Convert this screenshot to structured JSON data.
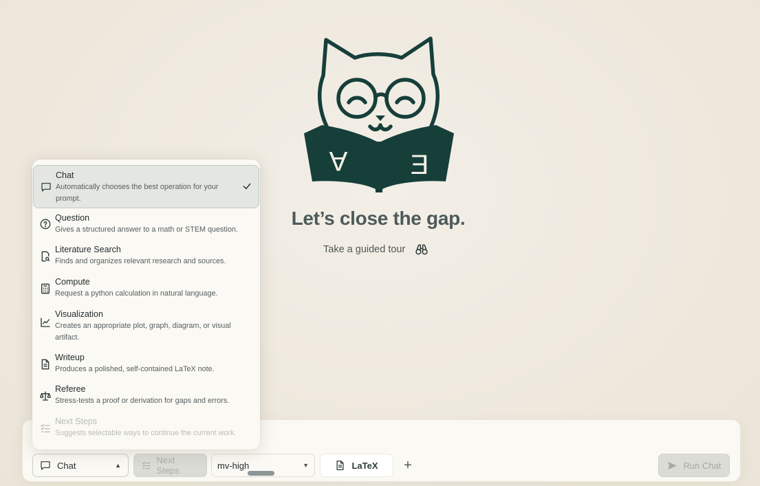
{
  "hero": {
    "headline": "Let’s close the gap.",
    "tour_label": "Take a guided tour",
    "tour_icon": "binoculars-icon",
    "logo": {
      "book_left_letter": "A",
      "book_right_letter": "E",
      "color": "#163f3a"
    }
  },
  "menu": {
    "items": [
      {
        "title": "Chat",
        "desc": "Automatically chooses the best operation for your prompt.",
        "icon": "chat-bubble-icon",
        "selected": true
      },
      {
        "title": "Question",
        "desc": "Gives a structured answer to a math or STEM question.",
        "icon": "question-circle-icon"
      },
      {
        "title": "Literature Search",
        "desc": "Finds and organizes relevant research and sources.",
        "icon": "document-search-icon"
      },
      {
        "title": "Compute",
        "desc": "Request a python calculation in natural language.",
        "icon": "calculator-icon"
      },
      {
        "title": "Visualization",
        "desc": "Creates an appropriate plot, graph, diagram, or visual artifact.",
        "icon": "line-chart-icon"
      },
      {
        "title": "Writeup",
        "desc": "Produces a polished, self-contained LaTeX note.",
        "icon": "document-icon"
      },
      {
        "title": "Referee",
        "desc": "Stress-tests a proof or derivation for gaps and errors.",
        "icon": "scale-icon"
      },
      {
        "title": "Next Steps",
        "desc": "Suggests selectable ways to continue the current work.",
        "icon": "checklist-icon",
        "disabled": true
      }
    ]
  },
  "toolbar": {
    "mode_value": "Chat",
    "next_steps_label": "Next Steps",
    "model_value": "mv-high",
    "latex_label": "LaTeX",
    "plus_label": "+",
    "run_label": "Run Chat"
  },
  "colors": {
    "accent": "#163f3a",
    "background": "#eee8dd",
    "surface": "#fbf9f4"
  }
}
